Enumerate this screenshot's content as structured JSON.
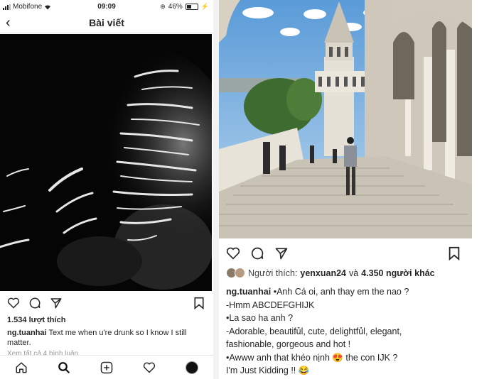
{
  "status": {
    "carrier": "Mobifone",
    "time": "09:09",
    "battery": "46%"
  },
  "nav": {
    "title": "Bài viết"
  },
  "left_post": {
    "likes": "1.534 lượt thích",
    "username": "ng.tuanhai",
    "caption": "Text me when u're drunk so I know I still matter.",
    "view_more": "Xem tất cả 4 bình luận"
  },
  "right_post": {
    "liked_prefix": "Người thích:",
    "liked_user": "yenxuan24",
    "liked_connector": "và",
    "liked_others": "4.350 người khác",
    "username": "ng.tuanhai",
    "caption_lines": [
      "•Anh Cá oi, anh thay em the nao ?",
      "-Hmm ABCDEFGHIJK",
      "•La sao ha anh ?",
      "-Adorable, beautifủl, cute, delightfủl, elegant,",
      "fashionable, gorgeous and hot !",
      "•Awww anh that khéo nịnh 😍 the con IJK ?",
      "I'm Just Kidding !! 😂"
    ]
  },
  "icons": [
    "heart-icon",
    "comment-icon",
    "share-icon",
    "bookmark-icon",
    "home-icon",
    "search-icon",
    "add-icon",
    "activity-icon",
    "profile-icon",
    "back-icon",
    "wifi-icon",
    "battery-icon"
  ]
}
